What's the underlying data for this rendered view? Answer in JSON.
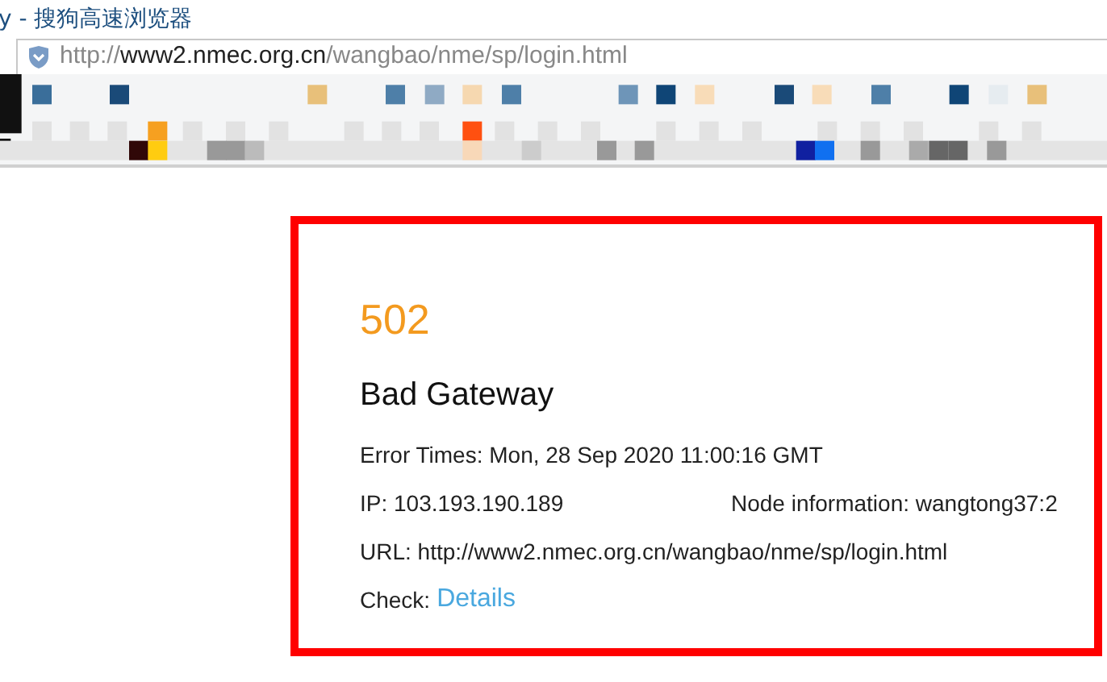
{
  "window": {
    "title": "y - 搜狗高速浏览器"
  },
  "address_bar": {
    "scheme": "http://",
    "host": "www2.nmec.org.cn",
    "path": "/wangbao/nme/sp/login.html"
  },
  "error": {
    "code": "502",
    "title": "Bad Gateway",
    "time": "Error Times: Mon, 28 Sep 2020 11:00:16 GMT",
    "ip": "IP: 103.193.190.189",
    "node": "Node information: wangtong37:2",
    "url": "URL: http://www2.nmec.org.cn/wangbao/nme/sp/login.html",
    "check_label": "Check:",
    "check_link": "Details"
  }
}
